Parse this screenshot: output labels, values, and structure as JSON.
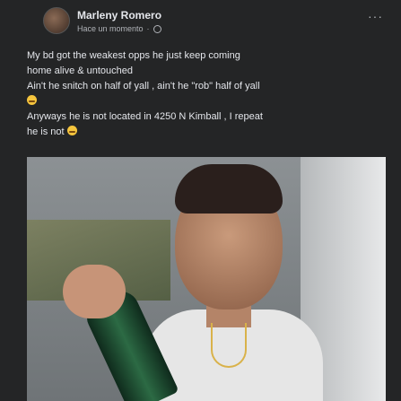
{
  "post": {
    "author": "Marleny Romero",
    "meta_text": "Hace un momento",
    "separator": "·",
    "more_label": "···",
    "lines": [
      "My bd got the weakest opps he just keep coming",
      "home alive & untouched",
      "Ain't he snitch on half of yall , ain't he \"rob\" half of yall",
      "Anyways he is not located in 4250 N Kimball , I repeat",
      "he is not"
    ]
  },
  "colors": {
    "background": "#242526",
    "text": "#e4e6eb",
    "secondary_text": "#b0b3b8"
  },
  "icons": {
    "privacy": "globe-icon",
    "more": "more-options-icon",
    "emoji": "emoji-icon"
  }
}
